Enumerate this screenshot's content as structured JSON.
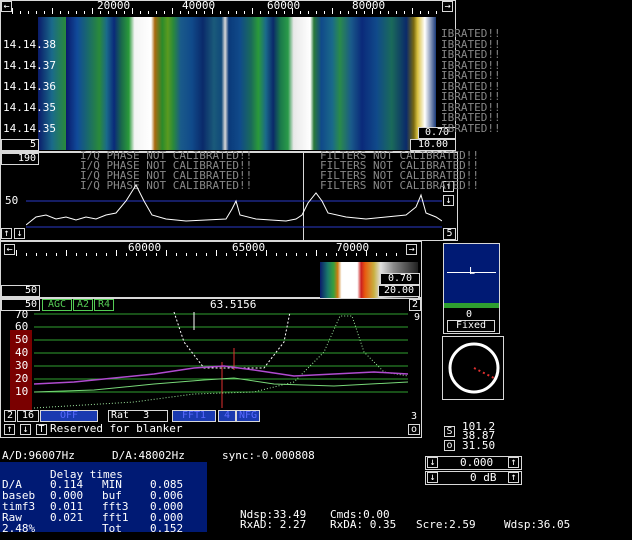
{
  "wf1": {
    "axis_ticks": [
      "20000",
      "40000",
      "60000",
      "80000"
    ],
    "times": [
      "14.14.38",
      "14.14.37",
      "14.14.36",
      "14.14.35",
      "14.14.35"
    ],
    "box_a": "0.70",
    "box_b": "10.00",
    "left_small": "5",
    "calib_repeat": "IBRATED!!"
  },
  "sp1": {
    "left_box": "190",
    "level": "50",
    "right_small": "5",
    "iq_msg": "I/Q PHASE NOT CALIBRATED!!",
    "filt_msg": "FILTERS NOT CALIBRATED!!"
  },
  "wf2": {
    "axis_ticks": [
      "60000",
      "65000",
      "70000"
    ],
    "box_a": "0.70",
    "box_b": "20.00",
    "left_small": "50"
  },
  "hr": {
    "num_left": "50",
    "agc": "AGC",
    "a2": "A2",
    "r4": "R4",
    "freq": "63.5156",
    "right_num": "2",
    "top_num": "9",
    "scale": [
      "70",
      "60",
      "50",
      "40",
      "30",
      "20",
      "10"
    ],
    "bottom_left": [
      "2",
      "16"
    ],
    "rat": "Rat",
    "rat_val": "3",
    "blue_a": "OFF",
    "blue_b": "FFT1",
    "blue_c": "AFC",
    "blue_d": "4",
    "blue_e": "NFG",
    "right_bottom": "3",
    "reserved": "Reserved for blanker",
    "t_btn": "T",
    "o_btn": "o"
  },
  "smeter": {
    "marker": "L",
    "value": "0",
    "mode": "Fixed"
  },
  "readout": {
    "s_label": "S",
    "s_val": "101.2",
    "mid_val": "38.87",
    "o_label": "o",
    "o_val": "31.50"
  },
  "status": {
    "ad": "A/D:96007Hz",
    "da": "D/A:48002Hz",
    "sync": "sync:-0.000808"
  },
  "delay": {
    "title": "Delay times",
    "rows": [
      [
        "D/A",
        "0.114",
        "MIN",
        "0.085"
      ],
      [
        "baseb",
        "0.000",
        "buf",
        "0.006"
      ],
      [
        "timf3",
        "0.011",
        "fft3",
        "0.000"
      ],
      [
        "Raw",
        "0.021",
        "fft1",
        "0.000"
      ],
      [
        "2.48%",
        "",
        "Tot",
        "0.152"
      ]
    ]
  },
  "stats": {
    "ndsp": "Ndsp:33.49",
    "cmds": "Cmds:0.00",
    "rxad": "RxAD: 2.27",
    "rxda": "RxDA: 0.35",
    "scre": "Scre:2.59",
    "wdsp": "Wdsp:36.05"
  },
  "volume": {
    "val1": "0.000",
    "val2": "0 dB"
  },
  "colors": {
    "blue_panel": "#001a74",
    "green_line": "#2f9f2f",
    "dark_red": "#7a0000",
    "purple": "#b04bd0",
    "white": "#ffffff"
  }
}
